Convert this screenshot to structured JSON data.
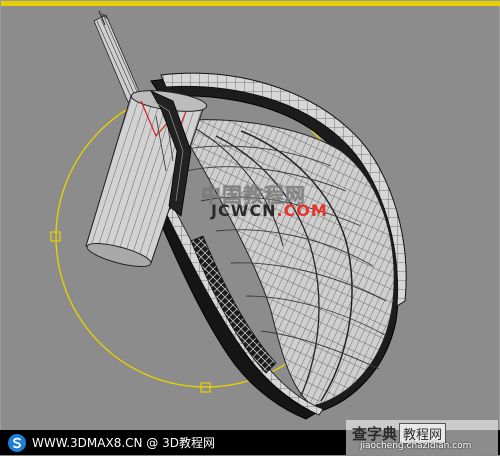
{
  "viewport": {
    "watermark_chinese": "中国教程网",
    "watermark_brand_a": "JCWCN",
    "watermark_brand_b": ".COM"
  },
  "footer": {
    "site_text": "WWW.3DMAX8.CN @ 3D教程网",
    "logo_icon": "s-swirl-icon"
  },
  "corner_watermark": {
    "title_main": "查字典",
    "title_box": "教程网",
    "url": "jiaocheng.chazidian.com"
  },
  "colors": {
    "viewport_bg": "#8c8c8c",
    "gizmo_yellow": "#e6d100",
    "mesh_light": "#d8d8d8",
    "mesh_dark": "#1a1a1a",
    "selection_red": "#d22020"
  }
}
